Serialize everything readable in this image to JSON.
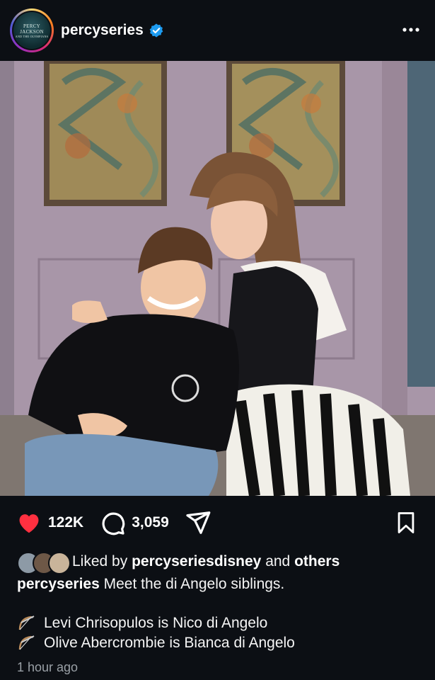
{
  "post": {
    "account": {
      "username": "percyseries",
      "verified": true,
      "avatar_text_line1": "PERCY",
      "avatar_text_line2": "JACKSON",
      "avatar_text_line3": "AND THE OLYMPIANS",
      "verified_color": "#1d9bf0"
    },
    "actions": {
      "likes": "122K",
      "comments": "3,059",
      "like_color": "#ff3040"
    },
    "liked_by": {
      "prefix": "Liked by",
      "user": "percyseriesdisney",
      "joiner": "and",
      "others": "others"
    },
    "caption": {
      "username": "percyseries",
      "text": "Meet the di Angelo siblings."
    },
    "credits": [
      "Levi Chrisopulos is Nico di Angelo",
      "Olive Abercrombie is Bianca di Angelo"
    ],
    "timestamp": "1 hour ago"
  },
  "icons": {
    "more": "more-options-icon",
    "like": "heart-icon",
    "comment": "comment-icon",
    "share": "send-icon",
    "save": "bookmark-icon",
    "emoji": "bow-and-arrow-icon"
  }
}
